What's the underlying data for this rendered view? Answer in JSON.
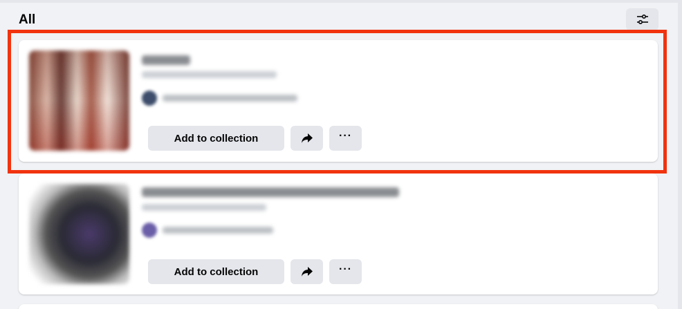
{
  "section": {
    "title": "All"
  },
  "filter": {
    "icon": "sliders-icon"
  },
  "items": [
    {
      "add_label": "Add to collection",
      "share_icon": "share-arrow-icon",
      "more_label": "···"
    },
    {
      "add_label": "Add to collection",
      "share_icon": "share-arrow-icon",
      "more_label": "···"
    }
  ],
  "highlight": {
    "color": "#f1330f"
  },
  "colors": {
    "page_bg": "#f0f2f5",
    "card_bg": "#ffffff",
    "button_bg": "#e4e6eb",
    "text": "#050505"
  }
}
